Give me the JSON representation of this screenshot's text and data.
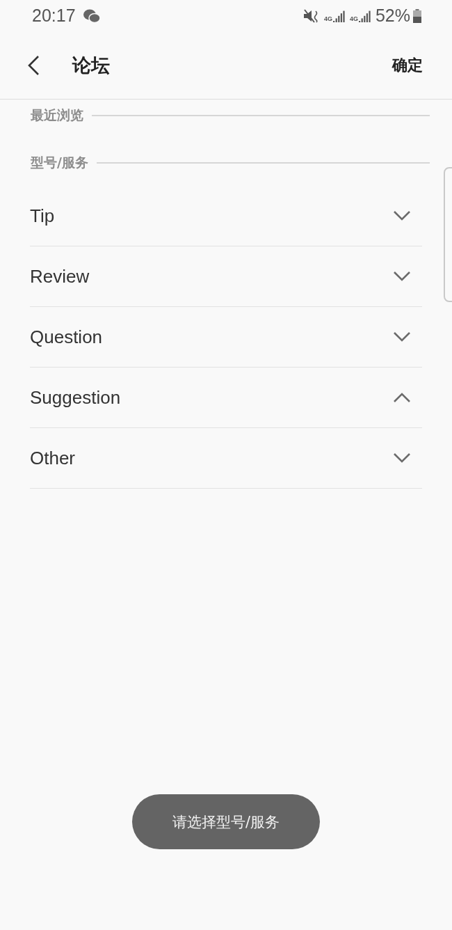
{
  "status_bar": {
    "time": "20:17",
    "network_labels": [
      "4G",
      "4G"
    ],
    "battery": "52%"
  },
  "header": {
    "title": "论坛",
    "confirm": "确定"
  },
  "sections": [
    {
      "title": "最近浏览"
    },
    {
      "title": "型号/服务"
    }
  ],
  "categories": [
    {
      "label": "Tip",
      "expanded": false
    },
    {
      "label": "Review",
      "expanded": false
    },
    {
      "label": "Question",
      "expanded": false
    },
    {
      "label": "Suggestion",
      "expanded": true
    },
    {
      "label": "Other",
      "expanded": false
    }
  ],
  "toast": "请选择型号/服务"
}
